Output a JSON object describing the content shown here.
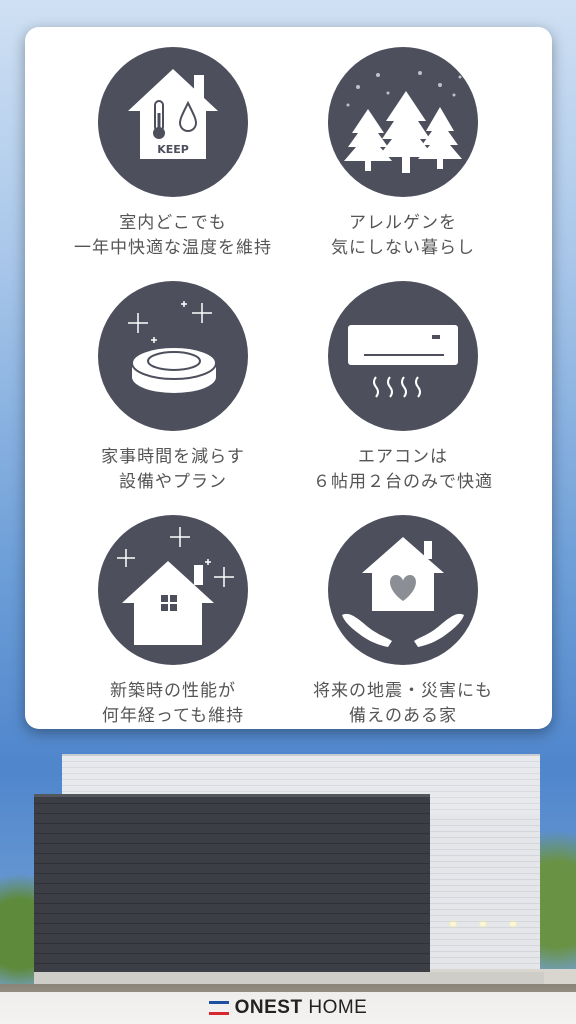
{
  "features": [
    {
      "icon": "thermometer-house-icon",
      "badge": "KEEP",
      "lines": [
        "室内どこでも",
        "一年中快適な温度を維持"
      ]
    },
    {
      "icon": "snowy-trees-icon",
      "lines": [
        "アレルゲンを",
        "気にしない暮らし"
      ]
    },
    {
      "icon": "robot-vacuum-icon",
      "lines": [
        "家事時間を減らす",
        "設備やプラン"
      ]
    },
    {
      "icon": "air-conditioner-icon",
      "lines": [
        "エアコンは",
        "６帖用２台のみで快適"
      ]
    },
    {
      "icon": "sparkling-house-icon",
      "lines": [
        "新築時の性能が",
        "何年経っても維持"
      ]
    },
    {
      "icon": "heart-house-hands-icon",
      "lines": [
        "将来の地震・災害にも",
        "備えのある家"
      ]
    }
  ],
  "brand": {
    "name_bold": "ONEST",
    "name_regular": "HOME",
    "colors": {
      "blue": "#1f4fa3",
      "red": "#d8282f"
    }
  }
}
